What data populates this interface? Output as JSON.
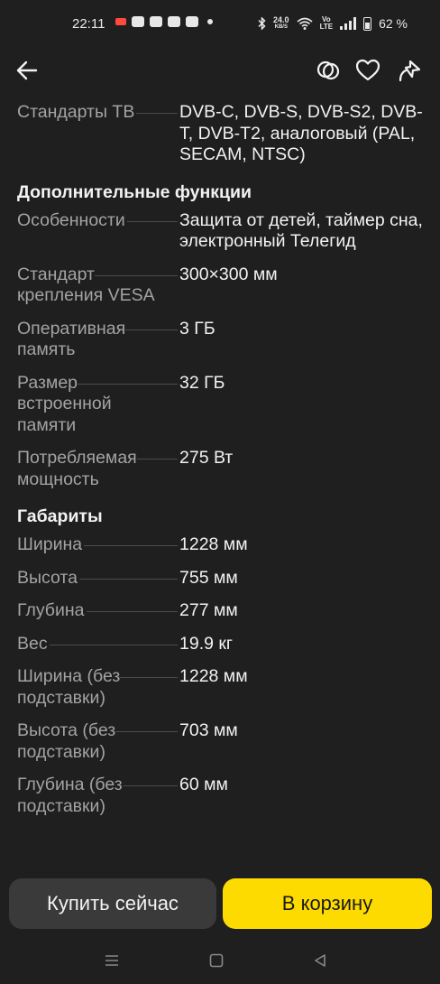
{
  "status_bar": {
    "time": "22:11",
    "speed_value": "24.0",
    "speed_unit": "KB/S",
    "lte_top": "Vo",
    "lte_bottom": "LTE",
    "battery": "62 %"
  },
  "nav": {
    "icons": [
      "back-arrow-icon",
      "compare-icon",
      "heart-icon",
      "share-icon"
    ]
  },
  "specs": {
    "tv_standards": {
      "label": "Стандарты ТВ",
      "value": "DVB-C, DVB-S, DVB-S2, DVB-T, DVB-T2, аналоговый (PAL, SECAM, NTSC)"
    },
    "section_extra": "Дополнительные функции",
    "extra": [
      {
        "label": "Особенности",
        "value": "Защита от детей, таймер сна, электронный Телегид"
      },
      {
        "label": "Стандарт крепления VESA",
        "value": "300×300 мм"
      },
      {
        "label": "Оперативная память",
        "value": "3 ГБ"
      },
      {
        "label": "Размер встроенной памяти",
        "value": "32 ГБ"
      },
      {
        "label": "Потребляемая мощность",
        "value": "275 Вт"
      }
    ],
    "section_dims": "Габариты",
    "dims": [
      {
        "label": "Ширина",
        "value": "1228 мм"
      },
      {
        "label": "Высота",
        "value": "755 мм"
      },
      {
        "label": "Глубина",
        "value": "277 мм"
      },
      {
        "label": "Вес",
        "value": "19.9 кг"
      },
      {
        "label": "Ширина (без подставки)",
        "value": "1228 мм"
      },
      {
        "label": "Высота (без подставки)",
        "value": "703 мм"
      },
      {
        "label": "Глубина (без подставки)",
        "value": "60 мм"
      }
    ]
  },
  "actions": {
    "buy_now": "Купить сейчас",
    "add_to_cart": "В корзину"
  },
  "colors": {
    "background": "#1f1f1f",
    "cart_button": "#fddb00",
    "buy_button": "#3a3a3a",
    "label_text": "#a3a3a3"
  }
}
